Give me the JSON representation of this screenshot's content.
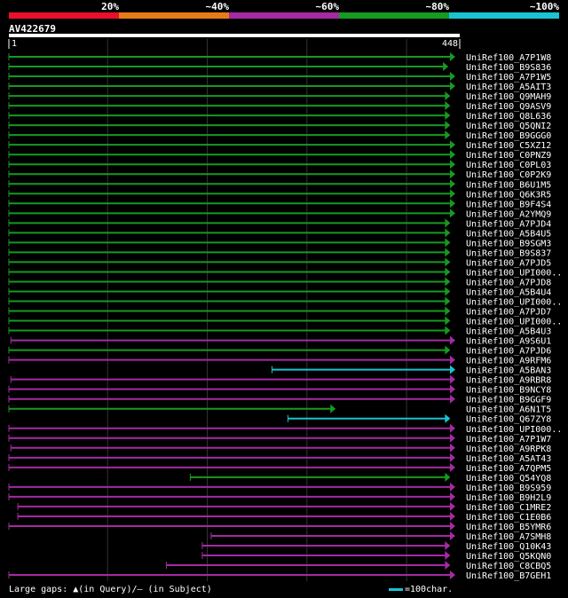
{
  "header": {
    "pct_labels": [
      "20%",
      "~40%",
      "~60%",
      "~80%",
      "~100%"
    ],
    "band_colors": [
      "#e8102b",
      "#e67b1a",
      "#a52aa3",
      "#169a20",
      "#19c3d2"
    ]
  },
  "query": {
    "name": "AV422679",
    "length": 448,
    "start": 1
  },
  "legend": {
    "gaps": "Large gaps: ▲(in Query)/‒ (in Subject)",
    "scale": "=100char."
  },
  "chart_data": {
    "type": "alignment",
    "xlim": [
      1,
      448
    ],
    "hits": [
      {
        "label": "UniRef100_A7P1W8",
        "start": 1,
        "end": 448,
        "color": "#169a20",
        "arrow": true
      },
      {
        "label": "UniRef100_B9S836",
        "start": 1,
        "end": 441,
        "color": "#169a20",
        "arrow": true
      },
      {
        "label": "UniRef100_A7P1W5",
        "start": 1,
        "end": 448,
        "color": "#169a20",
        "arrow": true
      },
      {
        "label": "UniRef100_A5AIT3",
        "start": 1,
        "end": 448,
        "color": "#169a20",
        "arrow": true
      },
      {
        "label": "UniRef100_Q9MAH9",
        "start": 1,
        "end": 443,
        "color": "#169a20",
        "arrow": true
      },
      {
        "label": "UniRef100_Q9ASV9",
        "start": 1,
        "end": 443,
        "color": "#169a20",
        "arrow": true
      },
      {
        "label": "UniRef100_Q8L636",
        "start": 1,
        "end": 443,
        "color": "#169a20",
        "arrow": true
      },
      {
        "label": "UniRef100_Q5QNI2",
        "start": 1,
        "end": 443,
        "color": "#169a20",
        "arrow": true
      },
      {
        "label": "UniRef100_B9GGG0",
        "start": 1,
        "end": 443,
        "color": "#169a20",
        "arrow": true
      },
      {
        "label": "UniRef100_C5XZ12",
        "start": 1,
        "end": 448,
        "color": "#169a20",
        "arrow": true
      },
      {
        "label": "UniRef100_C0PNZ9",
        "start": 1,
        "end": 448,
        "color": "#169a20",
        "arrow": true
      },
      {
        "label": "UniRef100_C0PL03",
        "start": 1,
        "end": 448,
        "color": "#169a20",
        "arrow": true
      },
      {
        "label": "UniRef100_C0P2K9",
        "start": 1,
        "end": 448,
        "color": "#169a20",
        "arrow": true
      },
      {
        "label": "UniRef100_B6U1M5",
        "start": 1,
        "end": 448,
        "color": "#169a20",
        "arrow": true
      },
      {
        "label": "UniRef100_Q6K3R5",
        "start": 1,
        "end": 448,
        "color": "#169a20",
        "arrow": true
      },
      {
        "label": "UniRef100_B9F4S4",
        "start": 1,
        "end": 448,
        "color": "#169a20",
        "arrow": true
      },
      {
        "label": "UniRef100_A2YMQ9",
        "start": 1,
        "end": 448,
        "color": "#169a20",
        "arrow": true
      },
      {
        "label": "UniRef100_A7PJD4",
        "start": 1,
        "end": 443,
        "color": "#169a20",
        "arrow": true
      },
      {
        "label": "UniRef100_A5B4U5",
        "start": 1,
        "end": 443,
        "color": "#169a20",
        "arrow": true
      },
      {
        "label": "UniRef100_B9SGM3",
        "start": 1,
        "end": 443,
        "color": "#169a20",
        "arrow": true
      },
      {
        "label": "UniRef100_B9S837",
        "start": 1,
        "end": 443,
        "color": "#169a20",
        "arrow": true
      },
      {
        "label": "UniRef100_A7PJD5",
        "start": 1,
        "end": 443,
        "color": "#169a20",
        "arrow": true
      },
      {
        "label": "UniRef100_UPI000..",
        "start": 1,
        "end": 443,
        "color": "#169a20",
        "arrow": true
      },
      {
        "label": "UniRef100_A7PJD8",
        "start": 1,
        "end": 443,
        "color": "#169a20",
        "arrow": true
      },
      {
        "label": "UniRef100_A5B4U4",
        "start": 1,
        "end": 443,
        "color": "#169a20",
        "arrow": true
      },
      {
        "label": "UniRef100_UPI000..",
        "start": 1,
        "end": 443,
        "color": "#169a20",
        "arrow": true
      },
      {
        "label": "UniRef100_A7PJD7",
        "start": 1,
        "end": 443,
        "color": "#169a20",
        "arrow": true
      },
      {
        "label": "UniRef100_UPI000..",
        "start": 1,
        "end": 443,
        "color": "#169a20",
        "arrow": true
      },
      {
        "label": "UniRef100_A5B4U3",
        "start": 1,
        "end": 443,
        "color": "#169a20",
        "arrow": true
      },
      {
        "label": "UniRef100_A9S6U1",
        "start": 3,
        "end": 448,
        "color": "#a52aa3",
        "arrow": true
      },
      {
        "label": "UniRef100_A7PJD6",
        "start": 1,
        "end": 443,
        "color": "#169a20",
        "arrow": true
      },
      {
        "label": "UniRef100_A9RFM6",
        "start": 1,
        "end": 448,
        "color": "#a52aa3",
        "arrow": true
      },
      {
        "label": "UniRef100_A5BAN3",
        "start": 265,
        "end": 448,
        "color": "#19c3d2",
        "arrow": true
      },
      {
        "label": "UniRef100_A9RBR8",
        "start": 3,
        "end": 448,
        "color": "#a52aa3",
        "arrow": true
      },
      {
        "label": "UniRef100_B9NCY8",
        "start": 1,
        "end": 448,
        "color": "#a52aa3",
        "arrow": true
      },
      {
        "label": "UniRef100_B9GGF9",
        "start": 1,
        "end": 448,
        "color": "#a52aa3",
        "arrow": true
      },
      {
        "label": "UniRef100_A6N1T5",
        "start": 1,
        "end": 328,
        "color": "#169a20",
        "arrow": true
      },
      {
        "label": "UniRef100_Q67ZY8",
        "start": 281,
        "end": 443,
        "color": "#19c3d2",
        "arrow": true
      },
      {
        "label": "UniRef100_UPI000..",
        "start": 1,
        "end": 448,
        "color": "#a52aa3",
        "arrow": true
      },
      {
        "label": "UniRef100_A7P1W7",
        "start": 1,
        "end": 448,
        "color": "#a52aa3",
        "arrow": true
      },
      {
        "label": "UniRef100_A9RPK8",
        "start": 3,
        "end": 448,
        "color": "#a52aa3",
        "arrow": true
      },
      {
        "label": "UniRef100_A5AT43",
        "start": 1,
        "end": 448,
        "color": "#a52aa3",
        "arrow": true
      },
      {
        "label": "UniRef100_A7QPM5",
        "start": 1,
        "end": 448,
        "color": "#a52aa3",
        "arrow": true
      },
      {
        "label": "UniRef100_Q54YQ8",
        "start": 183,
        "end": 443,
        "color": "#169a20",
        "arrow": true
      },
      {
        "label": "UniRef100_B9S959",
        "start": 1,
        "end": 448,
        "color": "#a52aa3",
        "arrow": true
      },
      {
        "label": "UniRef100_B9H2L9",
        "start": 1,
        "end": 448,
        "color": "#a52aa3",
        "arrow": true
      },
      {
        "label": "UniRef100_C1MRE2",
        "start": 10,
        "end": 448,
        "color": "#a52aa3",
        "arrow": true
      },
      {
        "label": "UniRef100_C1E0B6",
        "start": 10,
        "end": 448,
        "color": "#a52aa3",
        "arrow": true
      },
      {
        "label": "UniRef100_B5YMR6",
        "start": 1,
        "end": 448,
        "color": "#a52aa3",
        "arrow": true
      },
      {
        "label": "UniRef100_A7SMH8",
        "start": 204,
        "end": 448,
        "color": "#a52aa3",
        "arrow": true
      },
      {
        "label": "UniRef100_Q10K43",
        "start": 195,
        "end": 443,
        "color": "#a52aa3",
        "arrow": true
      },
      {
        "label": "UniRef100_Q5KQN0",
        "start": 195,
        "end": 443,
        "color": "#a52aa3",
        "arrow": true
      },
      {
        "label": "UniRef100_C8CBQ5",
        "start": 159,
        "end": 443,
        "color": "#a52aa3",
        "arrow": true
      },
      {
        "label": "UniRef100_B7GEH1",
        "start": 1,
        "end": 448,
        "color": "#a52aa3",
        "arrow": true
      }
    ]
  }
}
